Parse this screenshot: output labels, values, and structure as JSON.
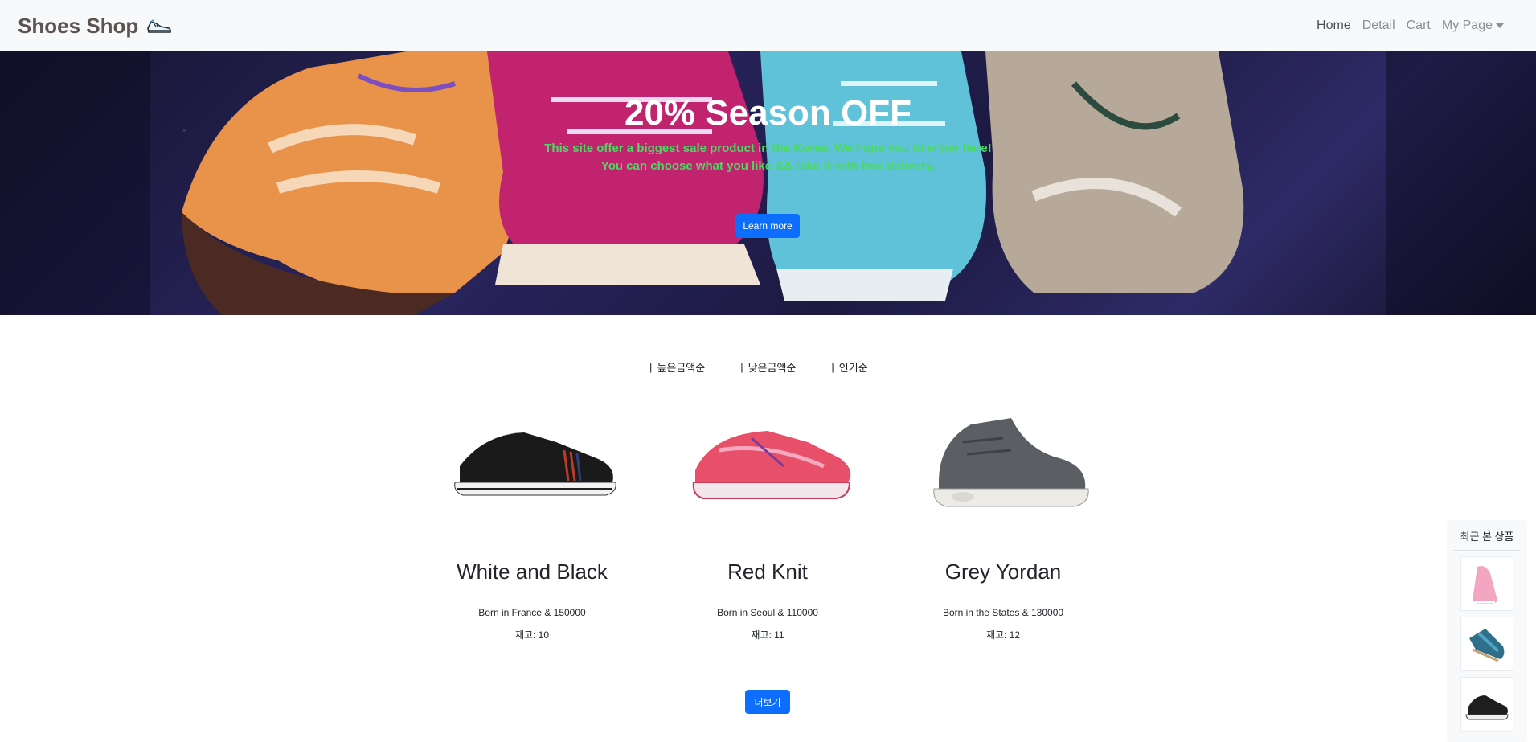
{
  "navbar": {
    "brand": "Shoes Shop",
    "brand_icon": "sneaker-icon",
    "links": [
      "Home",
      "Detail",
      "Cart"
    ],
    "my_page": "My Page"
  },
  "hero": {
    "title": "20% Season OFF",
    "line1": "This site offer a biggest sale product in the Korea. We hope you to enjoy here!",
    "line2": "You can choose what you like && take it with free delivery.",
    "button": "Learn more"
  },
  "sort": {
    "separator": "|",
    "options": [
      "높은금액순",
      "낮은금액순",
      "인기순"
    ]
  },
  "products": [
    {
      "title": "White and Black",
      "desc": "Born in France & 150000",
      "stock": "재고: 10"
    },
    {
      "title": "Red Knit",
      "desc": "Born in Seoul & 110000",
      "stock": "재고: 11"
    },
    {
      "title": "Grey Yordan",
      "desc": "Born in the States & 130000",
      "stock": "재고: 12"
    }
  ],
  "more_button": "더보기",
  "recent": {
    "title": "최근 본 상품"
  },
  "colors": {
    "primary": "#0d6efd",
    "hero_sub": "#4cd964",
    "navbar_bg": "#f8f9fa"
  }
}
